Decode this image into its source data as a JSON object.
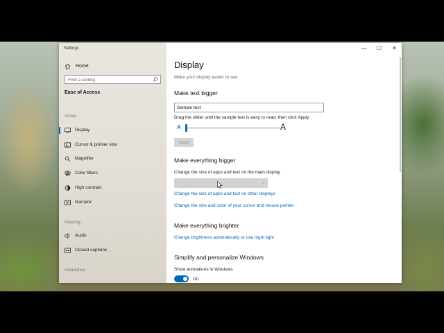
{
  "window": {
    "title": "Settings",
    "controls": {
      "minimize": "—",
      "maximize": "☐",
      "close": "✕"
    }
  },
  "sidebar": {
    "home_label": "Home",
    "search_placeholder": "Find a setting",
    "section_title": "Ease of Access",
    "groups": [
      {
        "label": "Vision",
        "items": [
          {
            "label": "Display",
            "icon": "monitor-icon",
            "active": true
          },
          {
            "label": "Cursor & pointer size",
            "icon": "cursor-icon"
          },
          {
            "label": "Magnifier",
            "icon": "magnifier-icon"
          },
          {
            "label": "Color filters",
            "icon": "color-filter-icon"
          },
          {
            "label": "High contrast",
            "icon": "high-contrast-icon"
          },
          {
            "label": "Narrator",
            "icon": "narrator-icon"
          }
        ]
      },
      {
        "label": "Hearing",
        "items": [
          {
            "label": "Audio",
            "icon": "speaker-icon"
          },
          {
            "label": "Closed captions",
            "icon": "closed-captions-icon"
          }
        ]
      },
      {
        "label": "Interaction",
        "items": []
      }
    ]
  },
  "main": {
    "title": "Display",
    "subtitle": "Make your display easier to see.",
    "text_bigger": {
      "heading": "Make text bigger",
      "sample_value": "Sample text",
      "instruction": "Drag the slider until the sample text is easy to read, then click Apply",
      "slider_min_label": "A",
      "slider_max_label": "A",
      "slider_level": 0.0,
      "apply_label": "Apply"
    },
    "everything_bigger": {
      "heading": "Make everything bigger",
      "description": "Change the size of apps and text on the main display",
      "dropdown_value": "",
      "link_other_displays": "Change the size of apps and text on other displays",
      "link_cursor": "Change the size and color of your cursor and mouse pointer"
    },
    "everything_brighter": {
      "heading": "Make everything brighter",
      "link_brightness": "Change brightness automatically or use night light"
    },
    "simplify": {
      "heading": "Simplify and personalize Windows",
      "animations_label": "Show animations in Windows",
      "animations_state": "On"
    }
  },
  "colors": {
    "accent": "#0067b8",
    "link": "#0063b1",
    "sidebar_bg": "#e6e2da"
  }
}
